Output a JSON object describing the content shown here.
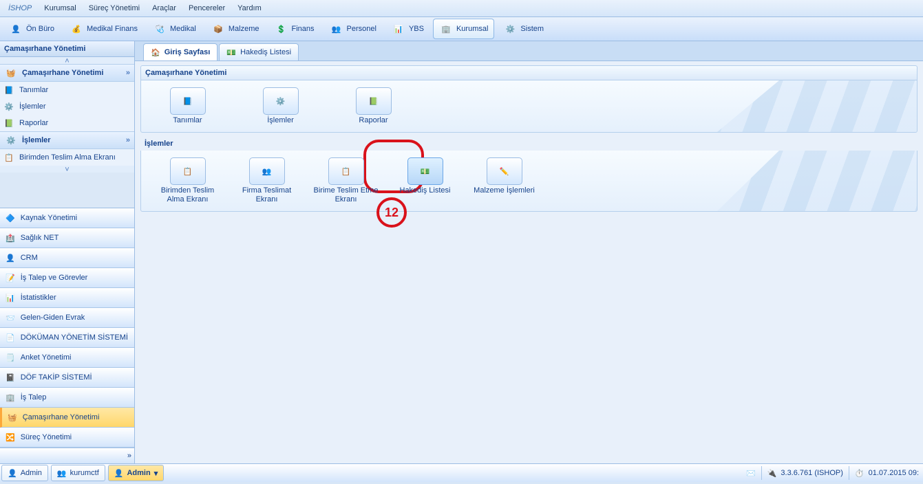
{
  "menubar": [
    "İSHOP",
    "Kurumsal",
    "Süreç Yönetimi",
    "Araçlar",
    "Pencereler",
    "Yardım"
  ],
  "toolbar": [
    {
      "label": "Ön Büro"
    },
    {
      "label": "Medikal Finans"
    },
    {
      "label": "Medikal"
    },
    {
      "label": "Malzeme"
    },
    {
      "label": "Finans"
    },
    {
      "label": "Personel"
    },
    {
      "label": "YBS"
    },
    {
      "label": "Kurumsal",
      "active": true
    },
    {
      "label": "Sistem"
    }
  ],
  "left": {
    "panel_title": "Çamaşırhane Yönetimi",
    "group1": {
      "title": "Çamaşırhane Yönetimi",
      "items": [
        "Tanımlar",
        "İşlemler",
        "Raporlar"
      ]
    },
    "group2": {
      "title": "İşlemler",
      "items": [
        "Birimden Teslim Alma Ekranı"
      ]
    }
  },
  "accordion": [
    "Kaynak Yönetimi",
    "Sağlık NET",
    "CRM",
    "İş Talep ve Görevler",
    "İstatistikler",
    "Gelen-Giden Evrak",
    "DÖKÜMAN YÖNETİM SİSTEMİ",
    "Anket Yönetimi",
    "DÖF TAKİP SİSTEMİ",
    "İş Talep",
    "Çamaşırhane Yönetimi",
    "Süreç Yönetimi"
  ],
  "accordion_active_index": 10,
  "tabs": [
    {
      "label": "Giriş Sayfası",
      "active": true
    },
    {
      "label": "Hakediş Listesi"
    }
  ],
  "page": {
    "group1": {
      "title": "Çamaşırhane Yönetimi",
      "items": [
        "Tanımlar",
        "İşlemler",
        "Raporlar"
      ]
    },
    "group2": {
      "title": "İşlemler",
      "items": [
        "Birimden Teslim Alma Ekranı",
        "Firma Teslimat Ekranı",
        "Birime Teslim Etme Ekranı",
        "Hakediş Listesi",
        "Malzeme İşlemleri"
      ],
      "selected_index": 3
    }
  },
  "annotation_number": "12",
  "status": {
    "left": [
      {
        "label": "Admin"
      },
      {
        "label": "kurumctf"
      },
      {
        "label": "Admin",
        "dropdown": true,
        "active": true
      }
    ],
    "version": "3.3.6.761 (ISHOP)",
    "date": "01.07.2015 09:"
  }
}
